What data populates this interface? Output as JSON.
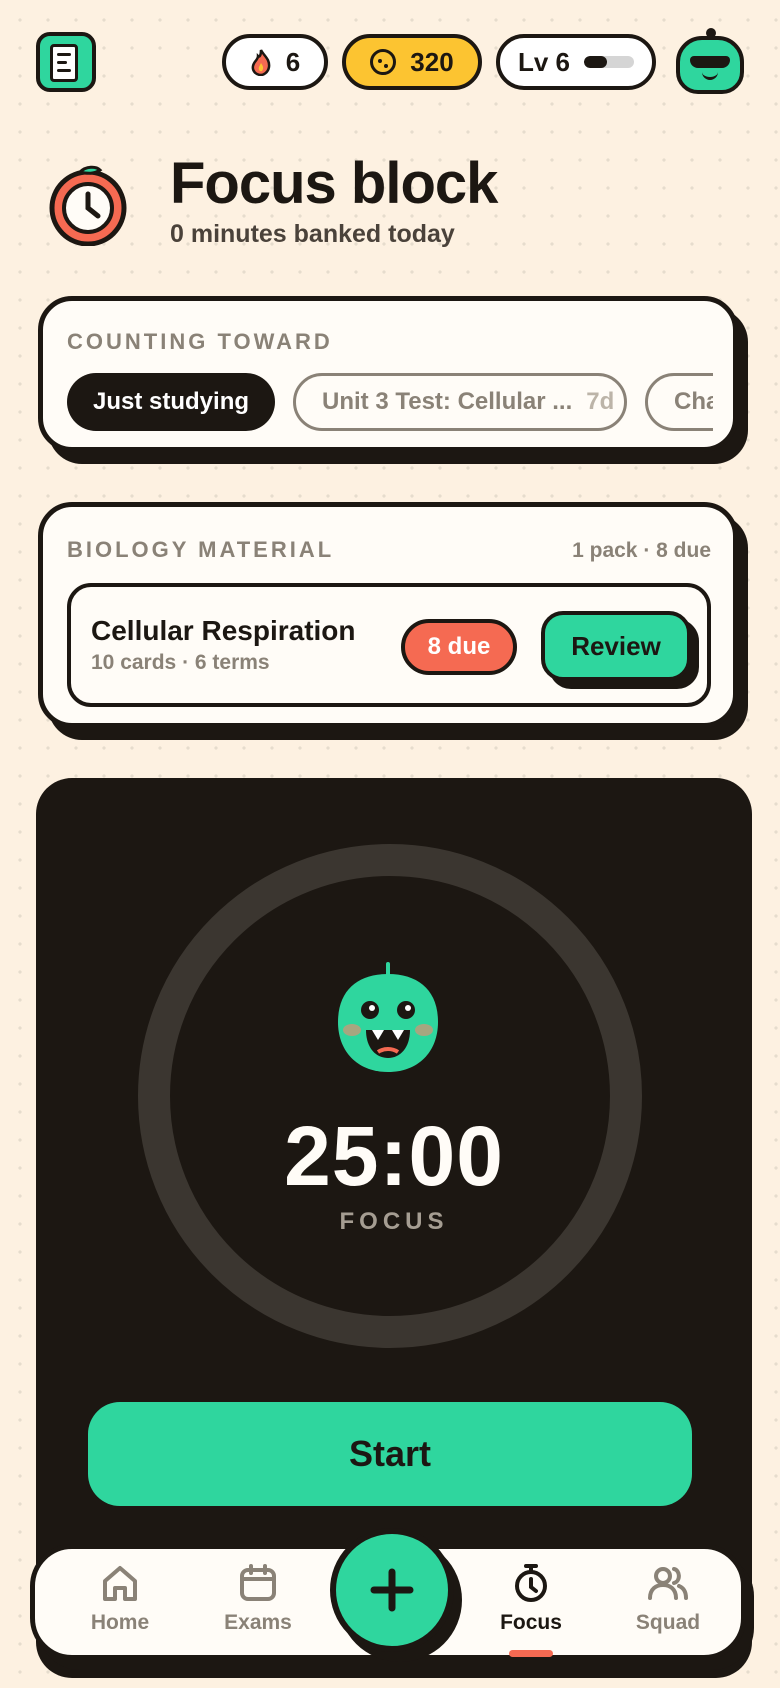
{
  "stats": {
    "streak": "6",
    "coins": "320",
    "level": "Lv 6",
    "level_progress": 0.45
  },
  "header": {
    "title": "Focus block",
    "subtitle": "0 minutes banked today"
  },
  "counting": {
    "label": "COUNTING TOWARD",
    "chips": [
      {
        "label": "Just studying",
        "days": ""
      },
      {
        "label": "Unit 3 Test: Cellular ...",
        "days": "7d"
      },
      {
        "label": "Cha",
        "days": ""
      }
    ]
  },
  "material": {
    "label": "BIOLOGY MATERIAL",
    "meta": "1 pack · 8 due",
    "pack": {
      "name": "Cellular Respiration",
      "sub": "10 cards · 6 terms",
      "due": "8 due",
      "review": "Review"
    }
  },
  "timer": {
    "time": "25:00",
    "mode": "FOCUS",
    "start": "Start"
  },
  "nav": {
    "items": [
      "Home",
      "Exams",
      "Focus",
      "Squad"
    ],
    "active": "Focus"
  },
  "colors": {
    "background": "#fdf1e1",
    "accent_green": "#2fd69e",
    "accent_red": "#f56a52",
    "coin_yellow": "#fcc431",
    "ink": "#1c1712"
  }
}
